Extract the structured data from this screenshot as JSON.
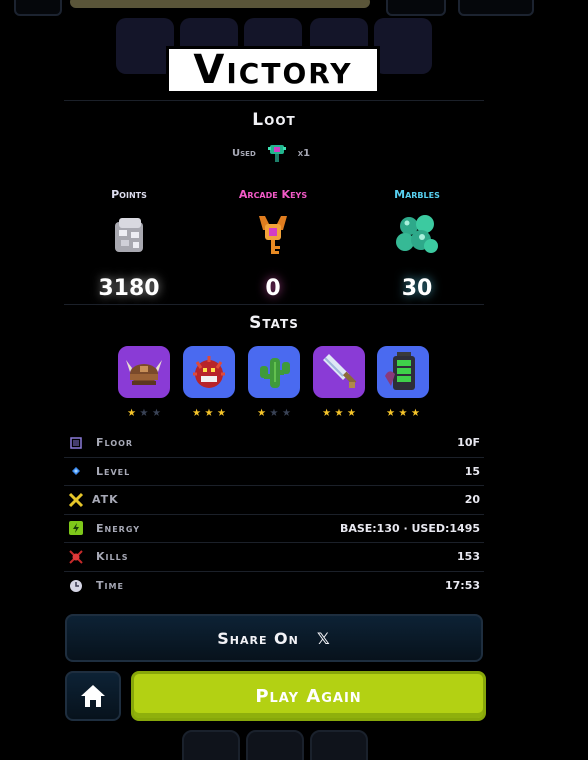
{
  "title": "Victory",
  "loot": {
    "section_title": "Loot",
    "used_label": "Used",
    "used_qty": "x1",
    "resources": [
      {
        "label": "Points",
        "value": "3180",
        "color": "#ddddee",
        "icon": "points-icon"
      },
      {
        "label": "Arcade Keys",
        "value": "0",
        "color": "#f25ac7",
        "icon": "arcade-key-icon"
      },
      {
        "label": "Marbles",
        "value": "30",
        "color": "#58d0f0",
        "icon": "marbles-icon"
      }
    ]
  },
  "stats": {
    "section_title": "Stats",
    "cards": [
      {
        "name": "viking-helmet",
        "stars": 1,
        "max_stars": 3,
        "color": "#8a3bd6"
      },
      {
        "name": "spiky-creature",
        "stars": 3,
        "max_stars": 3,
        "color": "#4a6af0"
      },
      {
        "name": "cactus",
        "stars": 1,
        "max_stars": 3,
        "color": "#4a6af0"
      },
      {
        "name": "crystal-sword",
        "stars": 3,
        "max_stars": 3,
        "color": "#8a3bd6"
      },
      {
        "name": "battery",
        "stars": 3,
        "max_stars": 3,
        "color": "#4a6af0"
      }
    ],
    "rows": [
      {
        "label": "Floor",
        "value": "10F",
        "icon": "floor-icon"
      },
      {
        "label": "Level",
        "value": "15",
        "icon": "level-icon"
      },
      {
        "label": "ATK",
        "value": "20",
        "icon": "atk-icon"
      },
      {
        "label": "Energy",
        "value": "BASE:130 · USED:1495",
        "icon": "energy-icon"
      },
      {
        "label": "Kills",
        "value": "153",
        "icon": "kills-icon"
      },
      {
        "label": "Time",
        "value": "17:53",
        "icon": "time-icon"
      }
    ]
  },
  "buttons": {
    "share_label": "Share On",
    "share_platform_glyph": "𝕏",
    "play_again_label": "Play Again"
  },
  "colors": {
    "accent_green": "#b3d113",
    "star_on": "#f6c52a",
    "star_off": "#3a4356"
  }
}
